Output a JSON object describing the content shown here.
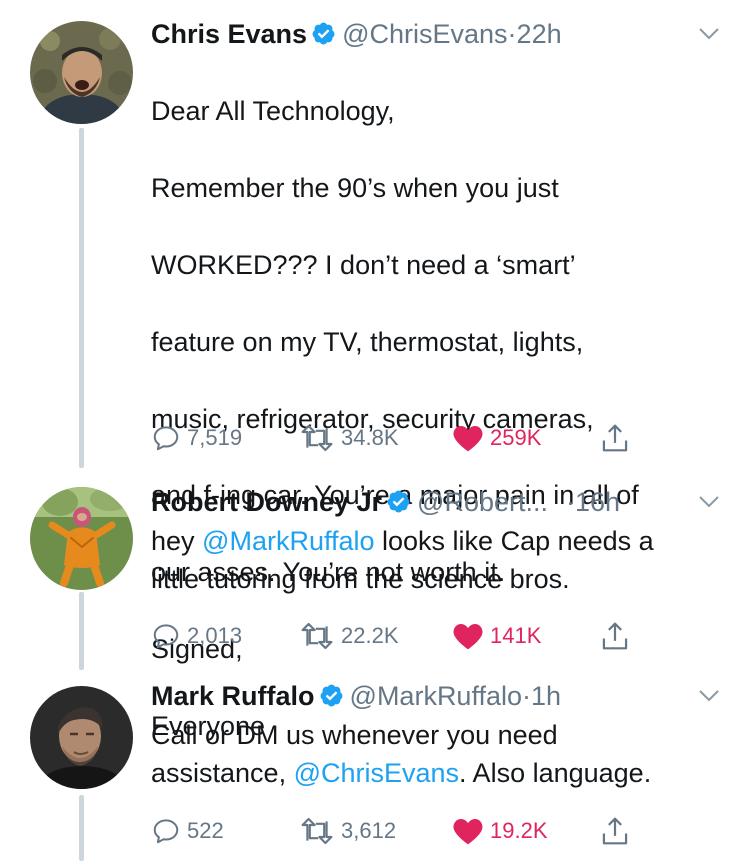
{
  "tweets": [
    {
      "name": "Chris Evans",
      "handle": "@ChrisEvans",
      "separator": "·",
      "time": "22h",
      "text_lines": [
        "Dear All Technology,",
        "Remember the 90’s when you just",
        "WORKED??? I don’t need a ‘smart’",
        "feature on my TV, thermostat, lights,",
        "music, refrigerator, security cameras,",
        "and f-ing car. You’re a major pain in all of",
        "our asses. You’re not worth it.",
        "Signed,",
        "Everyone"
      ],
      "replies": "7,519",
      "retweets": "34.8K",
      "likes": "259K"
    },
    {
      "name": "Robert Downey Jr",
      "handle": "@Robert...",
      "separator": "·",
      "time": "16h",
      "text_pre": "hey ",
      "mention": "@MarkRuffalo",
      "text_post": " looks like Cap needs a\nlittle tutoring from the science bros.",
      "replies": "2,013",
      "retweets": "22.2K",
      "likes": "141K"
    },
    {
      "name": "Mark Ruffalo",
      "handle": "@MarkRuffalo",
      "separator": "·",
      "time": "1h",
      "text_pre": "Call or DM us whenever you need\nassistance, ",
      "mention": "@ChrisEvans",
      "text_post": ". Also language.",
      "replies": "522",
      "retweets": "3,612",
      "likes": "19.2K"
    }
  ],
  "colors": {
    "text": "#14171a",
    "secondary": "#657786",
    "link": "#1da1f2",
    "like": "#e0245e",
    "thread_line": "#ccd6dd"
  },
  "icons": [
    "verified-badge-icon",
    "chevron-down-icon",
    "reply-icon",
    "retweet-icon",
    "heart-icon",
    "share-icon"
  ]
}
